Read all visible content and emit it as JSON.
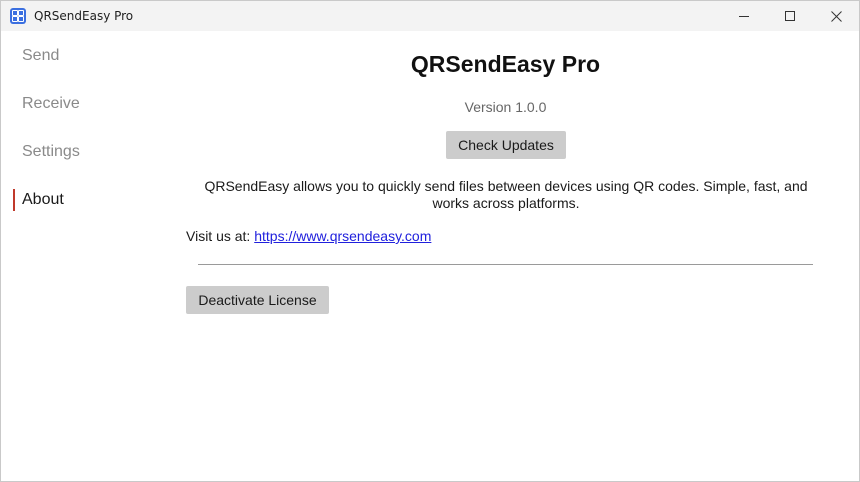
{
  "window": {
    "title": "QRSendEasy Pro",
    "controls": {
      "minimize_icon": "minimize-icon",
      "maximize_icon": "maximize-icon",
      "close_icon": "close-icon"
    }
  },
  "sidebar": {
    "items": [
      {
        "label": "Send",
        "active": false
      },
      {
        "label": "Receive",
        "active": false
      },
      {
        "label": "Settings",
        "active": false
      },
      {
        "label": "About",
        "active": true
      }
    ],
    "active_indicator_color": "#c0392b"
  },
  "about": {
    "app_name": "QRSendEasy Pro",
    "version": "Version 1.0.0",
    "check_updates_label": "Check Updates",
    "description": "QRSendEasy allows you to quickly send files between devices using QR codes. Simple, fast, and works across platforms.",
    "visit_label": "Visit us at:",
    "website_link": "https://www.qrsendeasy.com",
    "deactivate_label": "Deactivate License"
  },
  "colors": {
    "titlebar_bg": "#f3f3f3",
    "app_icon": "#3b6fe0",
    "button_bg": "#cccccc",
    "link": "#2020dd"
  }
}
